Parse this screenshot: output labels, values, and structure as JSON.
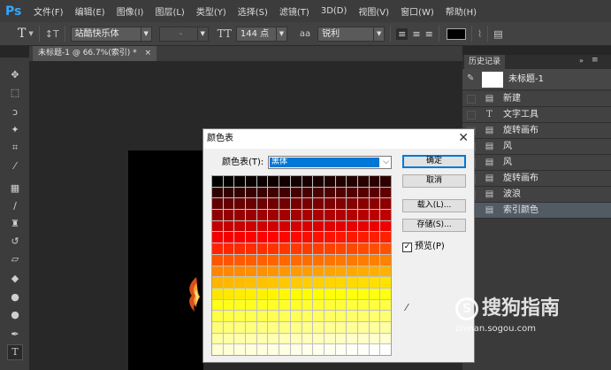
{
  "app": {
    "logo": "Ps"
  },
  "menubar": {
    "items": [
      "文件(F)",
      "编辑(E)",
      "图像(I)",
      "图层(L)",
      "类型(Y)",
      "选择(S)",
      "滤镜(T)",
      "3D(D)",
      "视图(V)",
      "窗口(W)",
      "帮助(H)"
    ]
  },
  "options": {
    "font_family": "站酷快乐体",
    "font_style": "-",
    "font_size": "144 点",
    "aa_label": "aa",
    "antialias": "锐利"
  },
  "document": {
    "tab_label": "未标题-1 @ 66.7%(索引) *"
  },
  "history": {
    "panel_title": "历史记录",
    "snapshot_label": "未标题-1",
    "items": [
      {
        "label": "新建",
        "icon": "doc-icon"
      },
      {
        "label": "文字工具",
        "icon": "type-icon"
      },
      {
        "label": "旋转画布",
        "icon": "doc-icon"
      },
      {
        "label": "风",
        "icon": "doc-icon"
      },
      {
        "label": "风",
        "icon": "doc-icon"
      },
      {
        "label": "旋转画布",
        "icon": "doc-icon"
      },
      {
        "label": "波浪",
        "icon": "doc-icon"
      },
      {
        "label": "索引颜色",
        "icon": "doc-icon"
      }
    ],
    "active_index": 7
  },
  "dialog": {
    "title": "颜色表",
    "table_label": "颜色表(T):",
    "table_value": "黑体",
    "ok": "确定",
    "cancel": "取消",
    "load": "载入(L)...",
    "save": "存储(S)...",
    "preview_label": "预览(P)",
    "preview_checked": "✓"
  },
  "watermark": {
    "brand": "搜狗指南",
    "logo_letter": "S",
    "url": "zhinan.sogou.com"
  },
  "colors": {
    "accent": "#0078d7",
    "app_bg": "#262626",
    "panel_bg": "#3a3a3a",
    "history_active": "#525a64"
  }
}
